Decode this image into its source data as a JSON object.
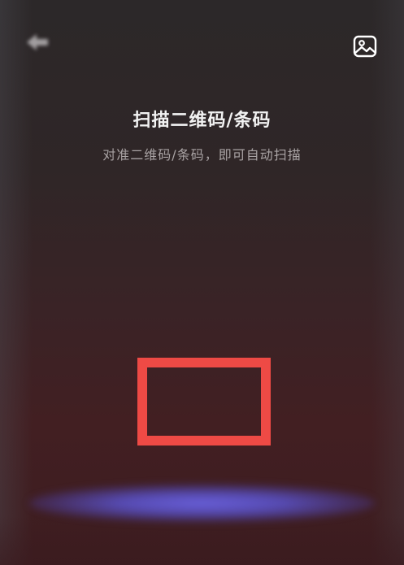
{
  "header": {
    "back_icon": "back-arrow-icon",
    "gallery_icon": "image-gallery-icon"
  },
  "scanner": {
    "title": "扫描二维码/条码",
    "subtitle": "对准二维码/条码，即可自动扫描",
    "frame_color": "#ee4a45",
    "scan_line_color": "#6a62e2"
  }
}
